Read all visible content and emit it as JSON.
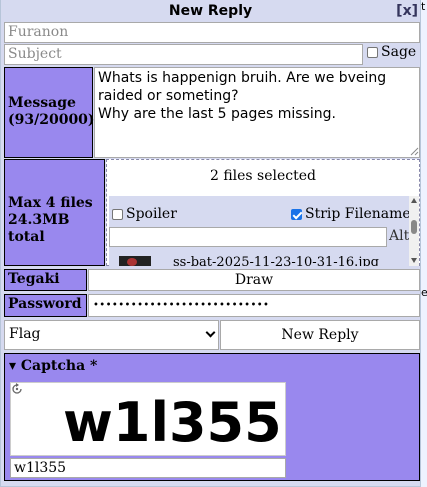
{
  "dialog": {
    "title": "New Reply",
    "close_label": "[x]"
  },
  "name_field": {
    "placeholder": "Furanon"
  },
  "subject_field": {
    "placeholder": "Subject"
  },
  "sage": {
    "label": "Sage",
    "checked": false
  },
  "message": {
    "label_line1": "Message",
    "label_line2": "(93/20000)",
    "text": "Whats is happenign bruih. Are we bveing raided or someting?\nWhy are the last 5 pages missing."
  },
  "files": {
    "label_line1": "Max 4 files",
    "label_line2": "24.3MB total",
    "status": "2 files selected",
    "spoiler_label": "Spoiler",
    "spoiler_checked": false,
    "strip_label": "Strip Filename",
    "strip_checked": true,
    "alt_label": "Alt",
    "file_name": "ss-bat-2025-11-23-10-31-16.jpg"
  },
  "tegaki": {
    "label": "Tegaki",
    "button": "Draw"
  },
  "password": {
    "label": "Password",
    "masked": "••••••••••••••••••••••••••••"
  },
  "flag": {
    "selected": "Flag"
  },
  "submit": {
    "label": "New Reply"
  },
  "captcha": {
    "title": "▾ Captcha *",
    "image_text": "w1l355",
    "answer": "w1l355"
  },
  "colors": {
    "label_bg": "#9988ee",
    "dialog_bg": "#d6daf0",
    "checkbox_checked": "#1a73e8"
  }
}
